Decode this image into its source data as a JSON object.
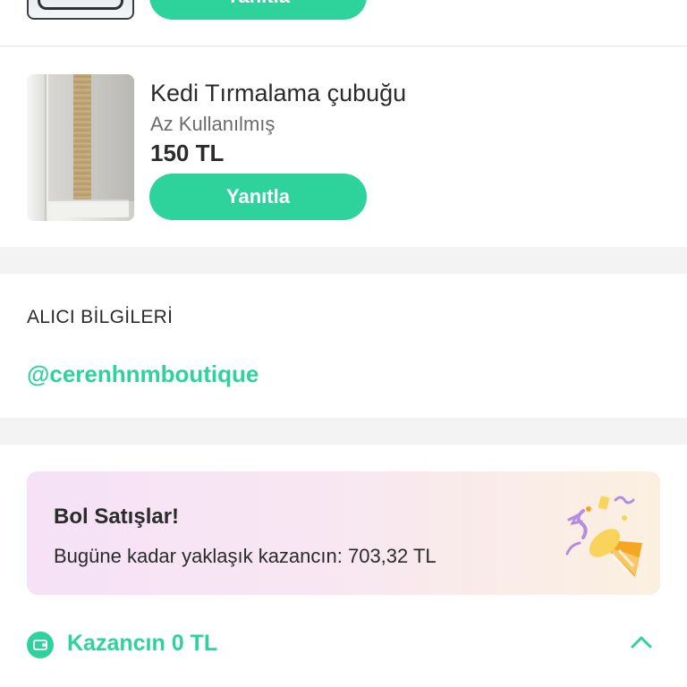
{
  "previous_item": {
    "reply_label": "Yanıtla"
  },
  "item": {
    "title": "Kedi Tırmalama çubuğu",
    "condition": "Az Kullanılmış",
    "price": "150 TL",
    "reply_label": "Yanıtla"
  },
  "buyer": {
    "heading": "ALICI BİLGİLERİ",
    "handle": "@cerenhnmboutique"
  },
  "promo": {
    "title": "Bol Satışlar!",
    "text": "Bugüne kadar yaklaşık kazancın: 703,32 TL",
    "icon": "party-popper-icon"
  },
  "earnings": {
    "label": "Kazancın 0 TL",
    "icon": "wallet-icon",
    "toggle_icon": "chevron-up-icon"
  },
  "colors": {
    "accent": "#2ed39b",
    "divider": "#f3f3f3"
  }
}
